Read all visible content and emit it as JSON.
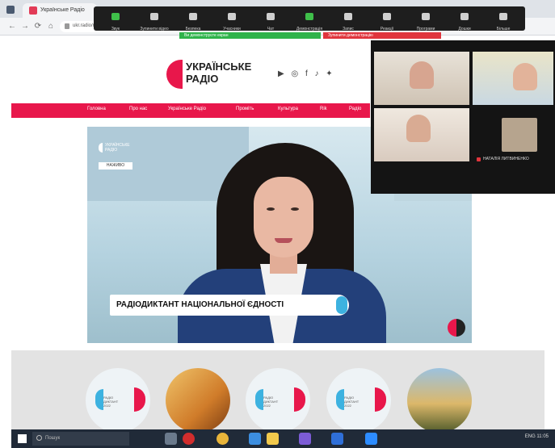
{
  "browser": {
    "tab_title": "Українське Радіо",
    "url": "ukr.radio/news.html"
  },
  "zoom": {
    "tools": [
      "Звук",
      "Зупинити відео",
      "Безпека",
      "Учасники",
      "Чат",
      "Демонстрація",
      "Запис",
      "Реакції",
      "Програми",
      "Дошки",
      "Більше"
    ],
    "notice_green": "Ви демонструєте екран",
    "notice_red": "Зупинити демонстрацію"
  },
  "site": {
    "logo": "УКРАЇНСЬКЕ\nРАДІО",
    "socials": "▶ ◎ f ♪ ✦",
    "nav": [
      "Головна",
      "Про нас",
      "Українське Радіо",
      "Проміть",
      "Культура",
      "Rik",
      "Радіо"
    ]
  },
  "video": {
    "logo_text": "УКРАЇНСЬКЕ\nРАДІО",
    "tag": "НАЖИВО",
    "caption": "РАДІОДИКТАНТ НАЦІОНАЛЬНОЇ ЄДНОСТІ"
  },
  "cards": [
    {
      "label": "РАДІО\nДИКТАНТ\n2022"
    },
    {
      "label": ""
    },
    {
      "label": "РАДІО\nДИКТАНТ\n2022"
    },
    {
      "label": "РАДІО\nДИКТАНТ\n2022"
    },
    {
      "label": ""
    }
  ],
  "participants": {
    "long_name": "НАТАЛІЯ ЛИТВИНЕНКО"
  },
  "taskbar": {
    "search": "Пошук",
    "tray": "ENG  11:05"
  },
  "colors": {
    "accent": "#e8174b",
    "zoom_bar": "#1e1e1e",
    "green": "#2fb34a",
    "red": "#e0353d"
  }
}
